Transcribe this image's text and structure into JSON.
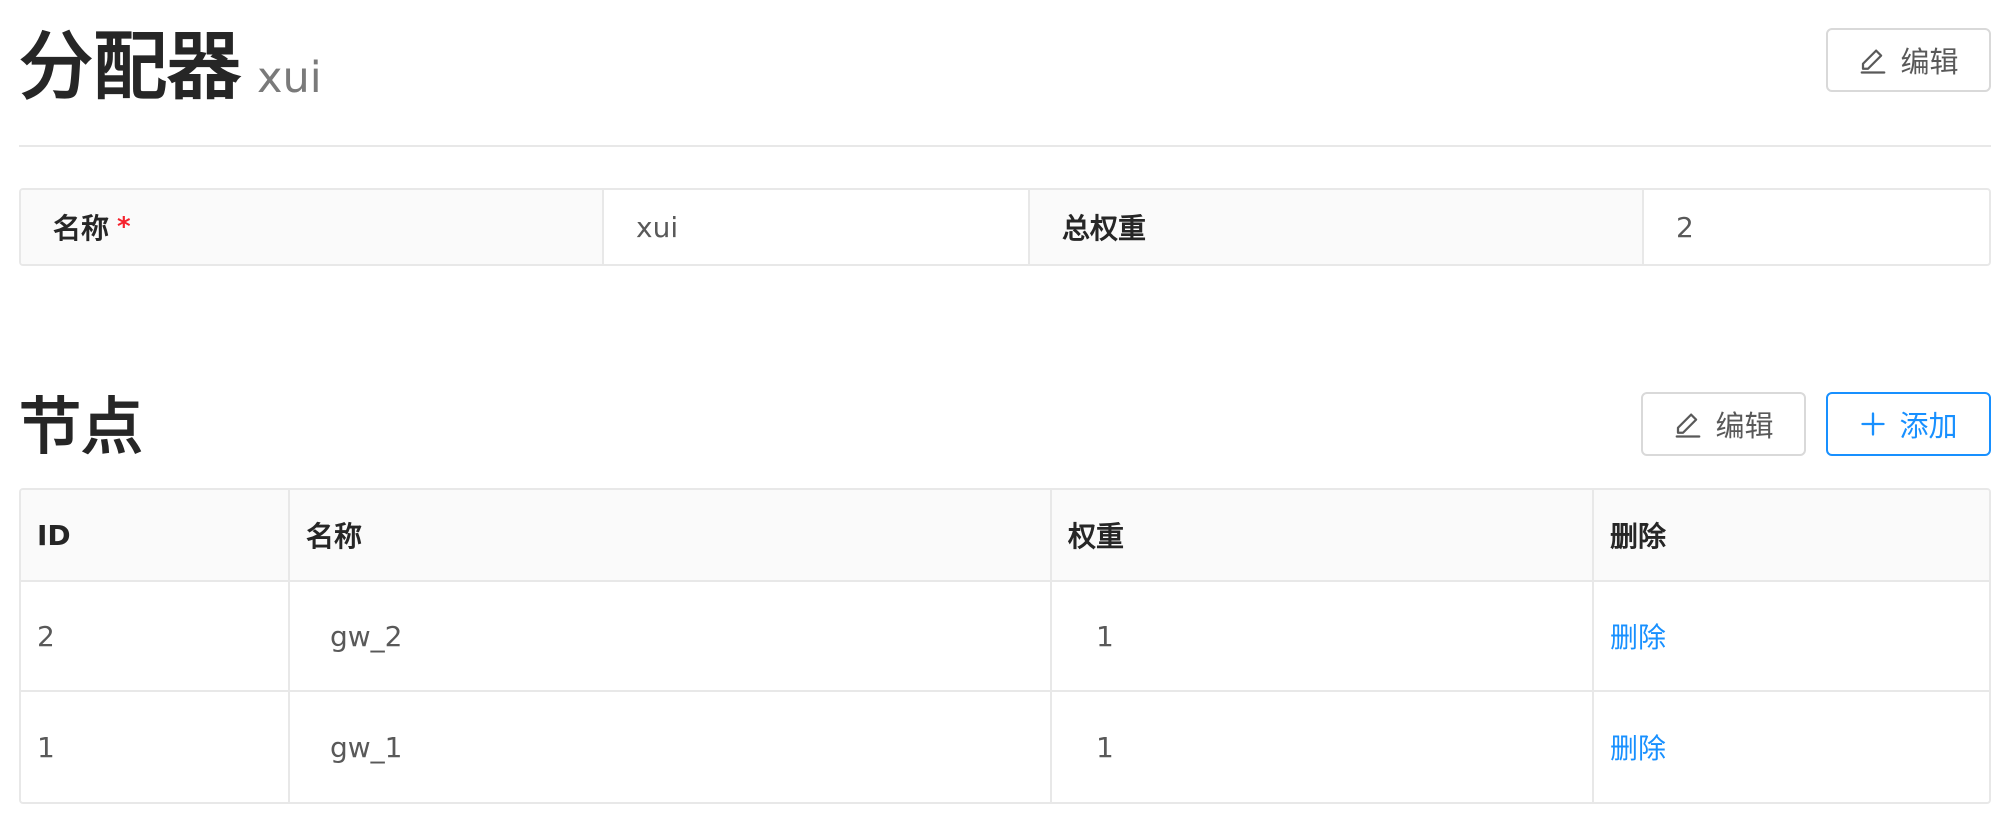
{
  "header": {
    "title": "分配器",
    "subtitle": "xui",
    "edit_label": "编辑"
  },
  "details": {
    "name_label": "名称",
    "required_mark": "*",
    "name_value": "xui",
    "total_weight_label": "总权重",
    "total_weight_value": "2"
  },
  "nodes": {
    "title": "节点",
    "edit_label": "编辑",
    "add_label": "添加",
    "columns": [
      "ID",
      "名称",
      "权重",
      "删除"
    ],
    "rows": [
      {
        "id": "2",
        "name": "gw_2",
        "weight": "1",
        "action": "删除"
      },
      {
        "id": "1",
        "name": "gw_1",
        "weight": "1",
        "action": "删除"
      }
    ]
  },
  "colors": {
    "primary": "#1890ff",
    "required": "#f5222d",
    "border": "#e8e8e8",
    "header_bg": "#fafafa"
  },
  "icons": [
    "edit-icon",
    "plus-icon"
  ]
}
